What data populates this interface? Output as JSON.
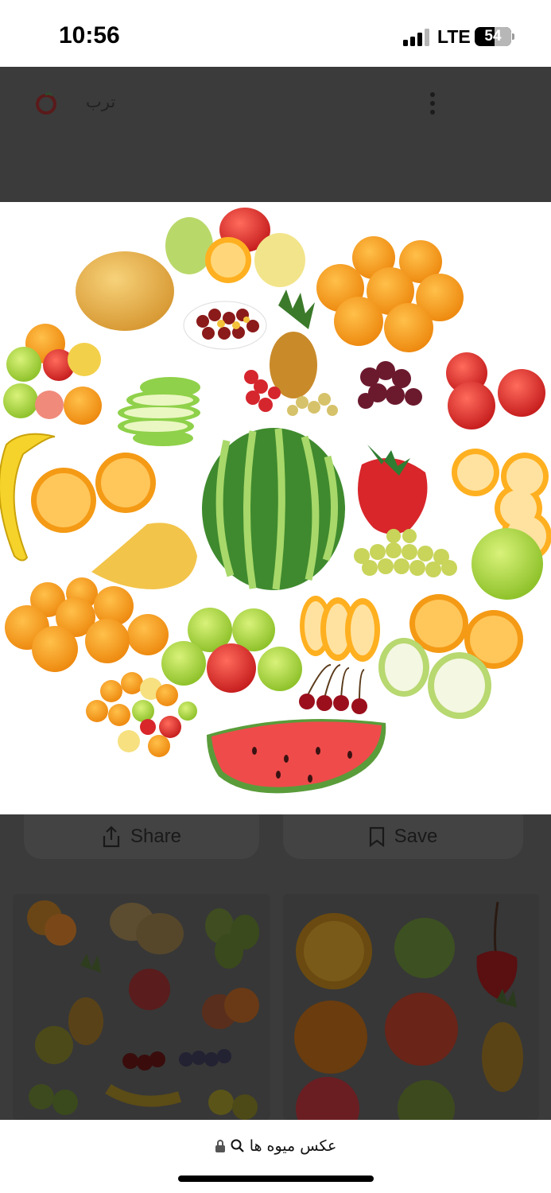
{
  "status_bar": {
    "time": "10:56",
    "network": "LTE",
    "battery": "54",
    "battery_level": 0.54
  },
  "header": {
    "site_name": "ترب"
  },
  "actions": {
    "share_label": "Share",
    "save_label": "Save"
  },
  "address_bar": {
    "url_text": "عکس میوه ها"
  },
  "colors": {
    "overlay": "#3b3b3b",
    "hero_bg": "#ffffff",
    "torob_red": "#c62828"
  }
}
